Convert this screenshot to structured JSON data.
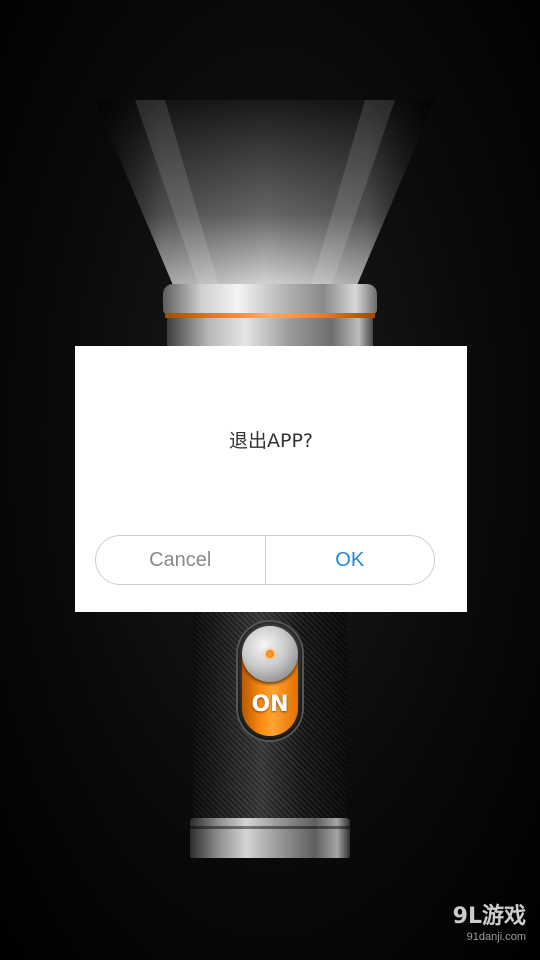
{
  "dialog": {
    "message": "退出APP?",
    "cancel_label": "Cancel",
    "ok_label": "OK"
  },
  "flashlight": {
    "switch_label": "ON",
    "switch_state": "on"
  },
  "watermark": {
    "main": "9L游戏",
    "sub": "91danji.com"
  },
  "colors": {
    "accent_orange": "#ff8c12",
    "ok_text": "#1e8ad6",
    "cancel_text": "#8a8a8a",
    "dialog_bg": "#ffffff",
    "screen_bg": "#000000"
  },
  "icons": {
    "switch_knob": "toggle-knob-icon",
    "indicator": "led-dot-icon"
  }
}
